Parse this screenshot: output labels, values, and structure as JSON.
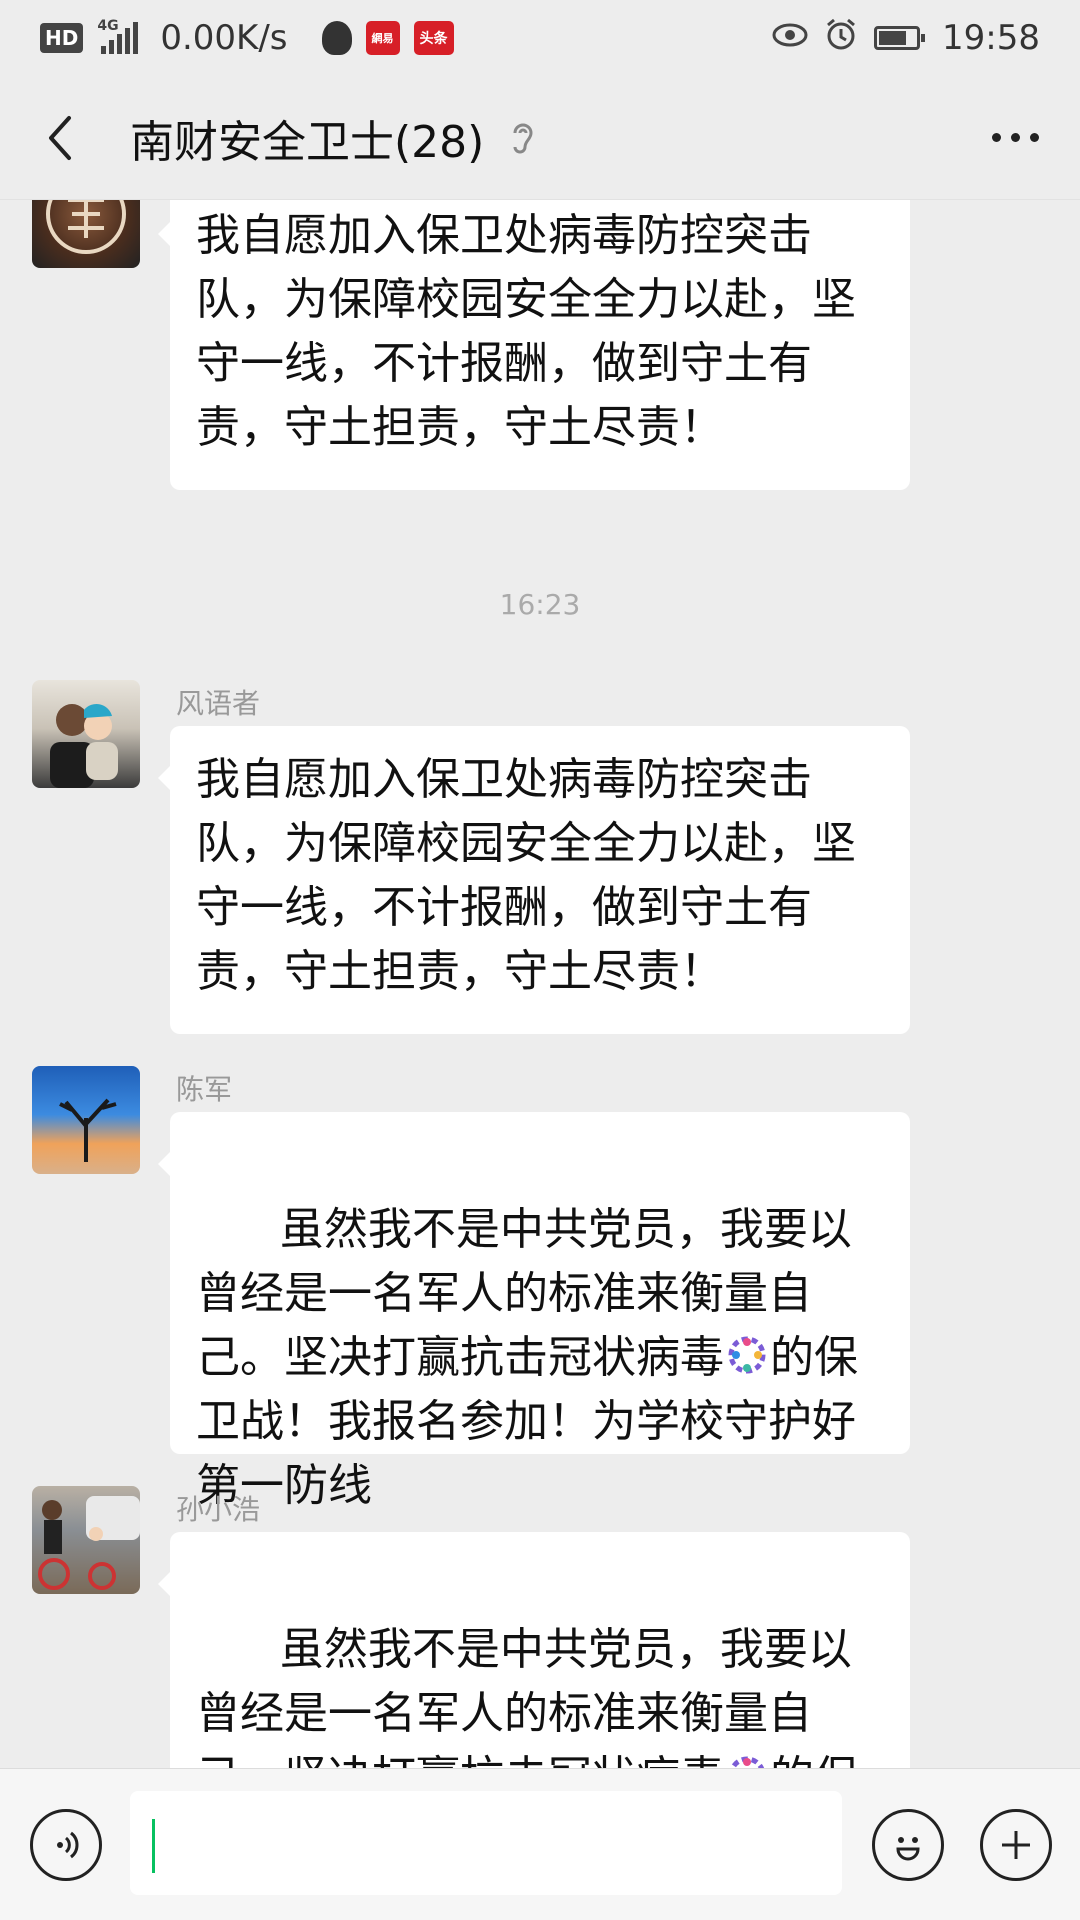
{
  "status_bar": {
    "hd_label": "HD",
    "network_label": "4G",
    "speed": "0.00K/s",
    "app_badge_1": "網易",
    "app_badge_2": "头条",
    "time": "19:58",
    "battery_level": 0.75
  },
  "nav": {
    "title": "南财安全卫士(28)"
  },
  "chat": {
    "messages": [
      {
        "sender": "",
        "text": "我自愿加入保卫处病毒防控突击队，为保障校园安全全力以赴，坚守一线，不计报酬，做到守土有责，守土担责，守土尽责！"
      },
      {
        "sender": "风语者",
        "text": "我自愿加入保卫处病毒防控突击队，为保障校园安全全力以赴，坚守一线，不计报酬，做到守土有责，守土担责，守土尽责！"
      },
      {
        "sender": "陈军",
        "text_before_emoji": "虽然我不是中共党员，我要以曾经是一名军人的标准来衡量自己。坚决打赢抗击冠状病毒",
        "text_after_emoji": "的保卫战！我报名参加！为学校守护好第一防线"
      },
      {
        "sender": "孙小浩",
        "text_before_emoji": "虽然我不是中共党员，我要以曾经是一名军人的标准来衡量自己。坚决打赢抗击冠状病毒",
        "text_after_emoji": "的保卫战！我报名参加！为学校守护好第一防线"
      }
    ],
    "timestamp": "16:23"
  },
  "input": {
    "value": ""
  },
  "colors": {
    "background": "#ededed",
    "bubble": "#ffffff",
    "accent": "#07c160"
  }
}
